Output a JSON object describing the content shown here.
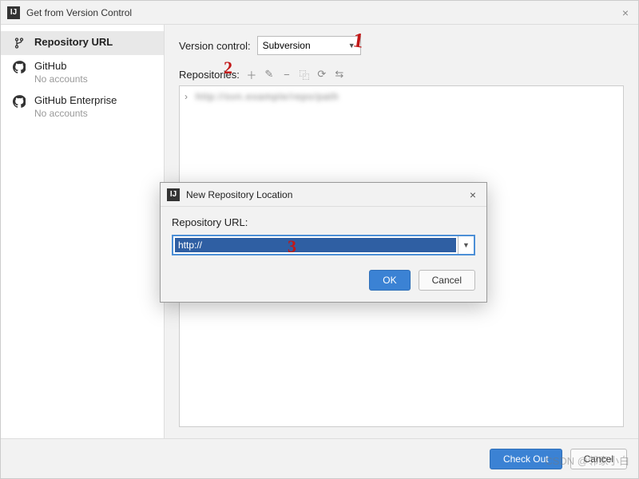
{
  "window": {
    "title": "Get from Version Control",
    "close_glyph": "×"
  },
  "sidebar": {
    "items": [
      {
        "label": "Repository URL",
        "sublabel": ""
      },
      {
        "label": "GitHub",
        "sublabel": "No accounts"
      },
      {
        "label": "GitHub Enterprise",
        "sublabel": "No accounts"
      }
    ]
  },
  "main": {
    "vc_label": "Version control:",
    "vc_value": "Subversion",
    "repos_label": "Repositories:"
  },
  "toolbar": {
    "add": "＋",
    "edit": "✎",
    "remove": "−",
    "copy": "⿻",
    "refresh": "⟳",
    "settings": "⇆"
  },
  "repo_list": {
    "row0_chev": "›",
    "row0_text": "http://svn.example/repo/path"
  },
  "footer": {
    "checkout": "Check Out",
    "cancel": "Cancel"
  },
  "dialog": {
    "title": "New Repository Location",
    "close_glyph": "×",
    "url_label": "Repository URL:",
    "url_value": "http://",
    "ok": "OK",
    "cancel": "Cancel"
  },
  "annotations": {
    "a1": "1",
    "a2": "2",
    "a3": "3"
  },
  "watermark": "CSDN @邻家小白"
}
